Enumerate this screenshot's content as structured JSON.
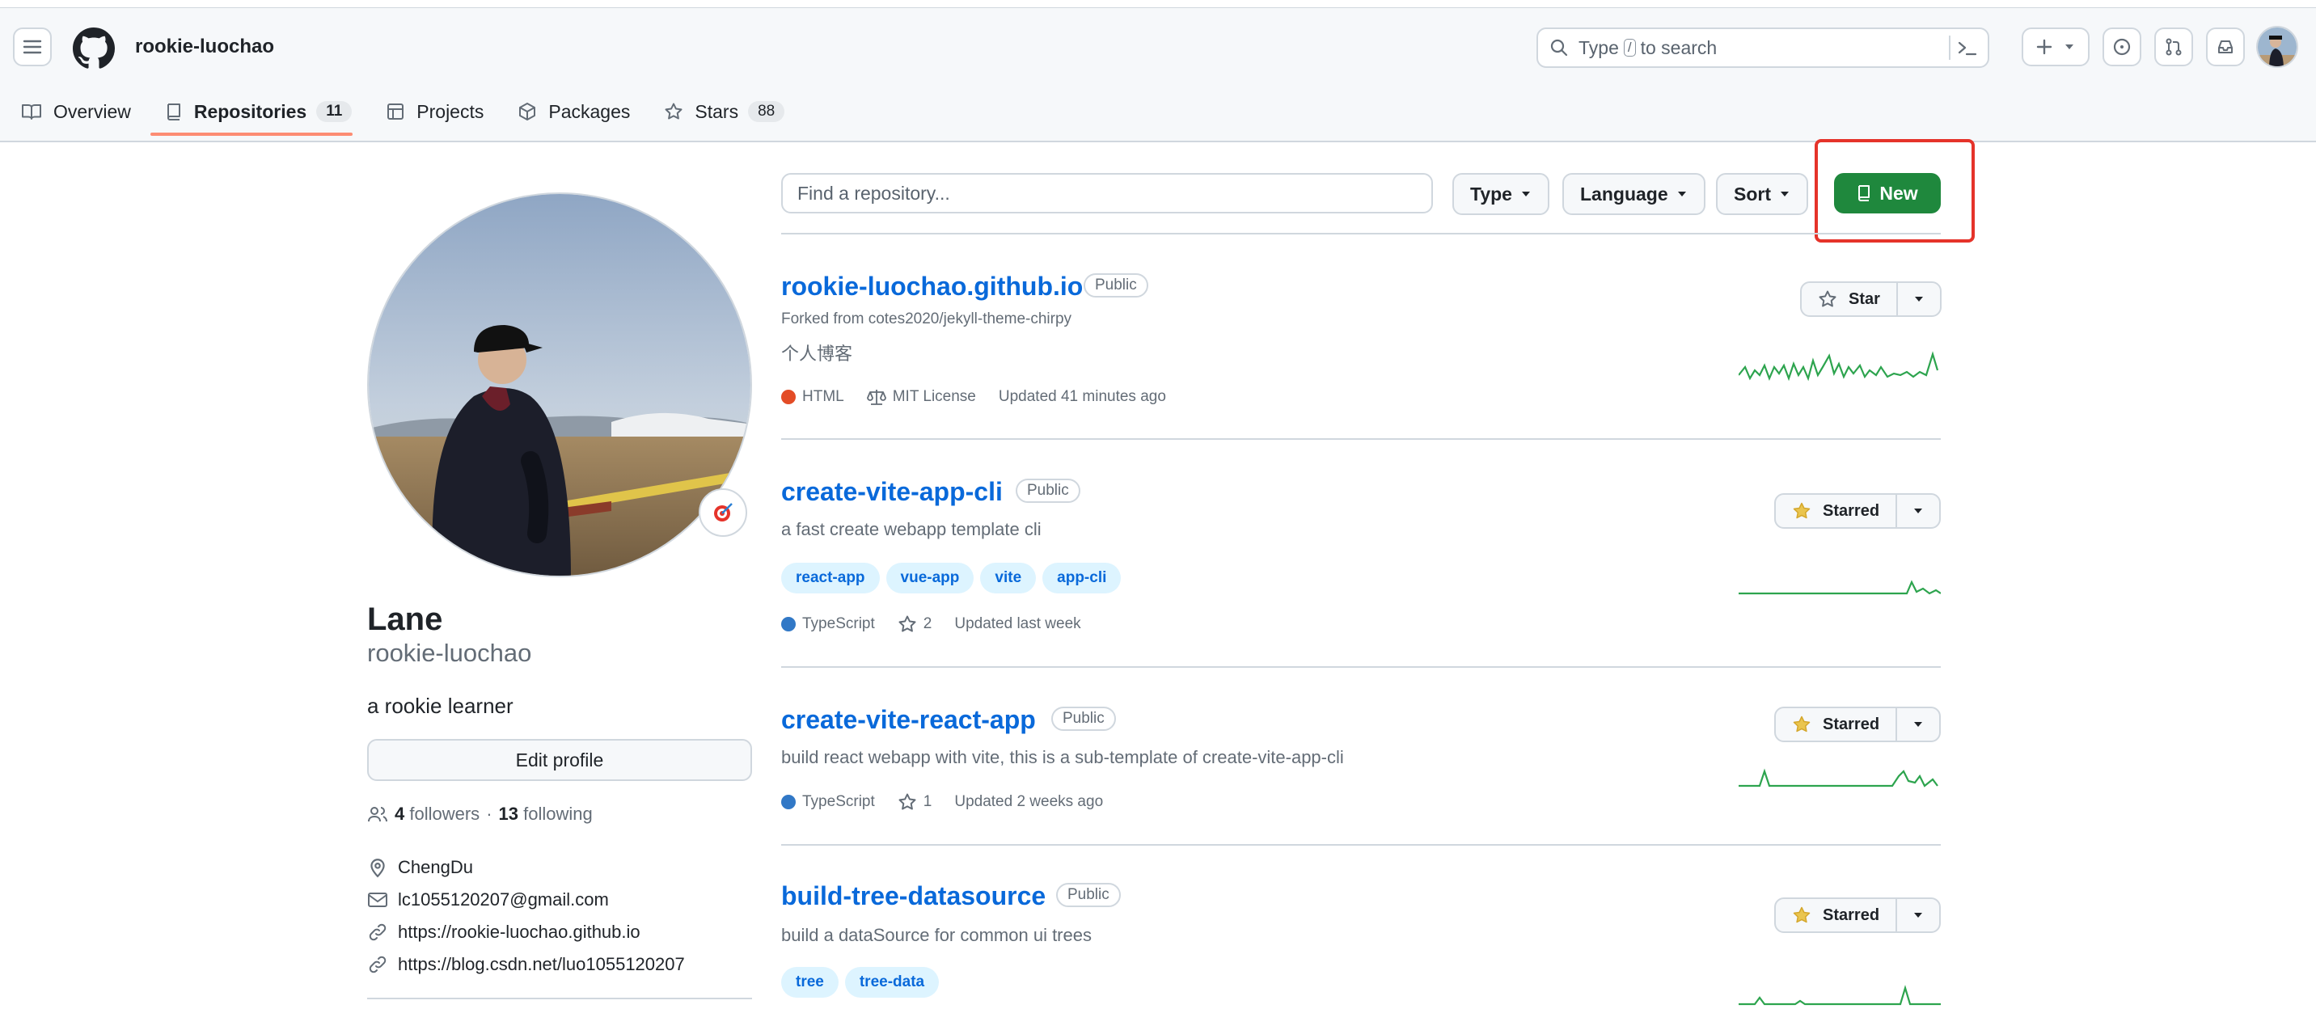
{
  "header": {
    "username": "rookie-luochao",
    "search": {
      "prefix": "Type",
      "key": "/",
      "suffix": "to search"
    }
  },
  "tabs": [
    {
      "label": "Overview",
      "count": ""
    },
    {
      "label": "Repositories",
      "count": "11"
    },
    {
      "label": "Projects",
      "count": ""
    },
    {
      "label": "Packages",
      "count": ""
    },
    {
      "label": "Stars",
      "count": "88"
    }
  ],
  "profile": {
    "name": "Lane",
    "login": "rookie-luochao",
    "bio": "a rookie learner",
    "edit_label": "Edit profile",
    "followers": "4",
    "followers_label": "followers",
    "following": "13",
    "following_label": "following",
    "location": "ChengDu",
    "email": "lc1055120207@gmail.com",
    "links": [
      "https://rookie-luochao.github.io",
      "https://blog.csdn.net/luo1055120207"
    ]
  },
  "filters": {
    "find_placeholder": "Find a repository...",
    "type_label": "Type",
    "language_label": "Language",
    "sort_label": "Sort",
    "new_label": "New"
  },
  "repos": [
    {
      "name": "rookie-luochao.github.io",
      "visibility": "Public",
      "forked_from": "Forked from cotes2020/jekyll-theme-chirpy",
      "description": "个人博客",
      "language": "HTML",
      "language_color": "#e34c26",
      "license": "MIT License",
      "updated": "Updated 41 minutes ago",
      "star_label": "Star"
    },
    {
      "name": "create-vite-app-cli",
      "visibility": "Public",
      "description": "a fast create webapp template cli",
      "topics": [
        "react-app",
        "vue-app",
        "vite",
        "app-cli"
      ],
      "language": "TypeScript",
      "language_color": "#3178c6",
      "stars": "2",
      "updated": "Updated last week",
      "star_label": "Starred"
    },
    {
      "name": "create-vite-react-app",
      "visibility": "Public",
      "description": "build react webapp with vite, this is a sub-template of create-vite-app-cli",
      "language": "TypeScript",
      "language_color": "#3178c6",
      "stars": "1",
      "updated": "Updated 2 weeks ago",
      "star_label": "Starred"
    },
    {
      "name": "build-tree-datasource",
      "visibility": "Public",
      "description": "build a dataSource for common ui trees",
      "topics": [
        "tree",
        "tree-data"
      ],
      "star_label": "Starred"
    }
  ]
}
